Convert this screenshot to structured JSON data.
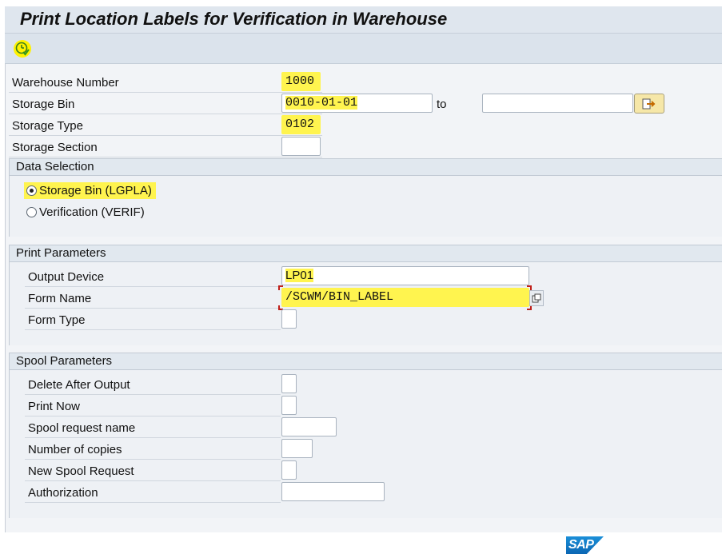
{
  "title": "Print Location Labels for Verification in Warehouse",
  "toolbar": {
    "execute_icon": "execute-clock-icon"
  },
  "selection": {
    "warehouse_number": {
      "label": "Warehouse Number",
      "value": "1000"
    },
    "storage_bin": {
      "label": "Storage Bin",
      "from": "0010-01-01",
      "to_label": "to",
      "to": ""
    },
    "storage_type": {
      "label": "Storage Type",
      "value": "0102"
    },
    "storage_section": {
      "label": "Storage Section",
      "value": ""
    }
  },
  "data_selection": {
    "heading": "Data Selection",
    "options": [
      {
        "label": "Storage Bin (LGPLA)",
        "selected": true
      },
      {
        "label": "Verification (VERIF)",
        "selected": false
      }
    ]
  },
  "print_parameters": {
    "heading": "Print Parameters",
    "output_device": {
      "label": "Output Device",
      "value": "LP01"
    },
    "form_name": {
      "label": "Form Name",
      "value": "/SCWM/BIN_LABEL"
    },
    "form_type": {
      "label": "Form Type",
      "value": ""
    }
  },
  "spool_parameters": {
    "heading": "Spool Parameters",
    "delete_after_output": {
      "label": "Delete After Output",
      "value": ""
    },
    "print_now": {
      "label": "Print Now",
      "value": ""
    },
    "spool_request_name": {
      "label": "Spool request name",
      "value": ""
    },
    "number_of_copies": {
      "label": "Number of copies",
      "value": ""
    },
    "new_spool_request": {
      "label": "New Spool Request",
      "value": ""
    },
    "authorization": {
      "label": "Authorization",
      "value": ""
    }
  },
  "footer": {
    "logo_text": "SAP"
  },
  "colors": {
    "highlight": "#fff44f",
    "title_bar": "#dfe6ee",
    "section_head": "#e1e8ef"
  }
}
